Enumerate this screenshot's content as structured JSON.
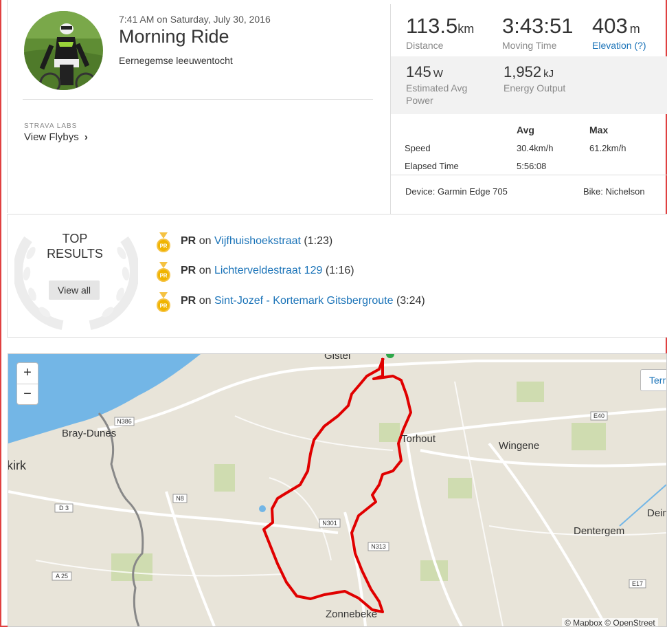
{
  "activity": {
    "datetime": "7:41 AM on Saturday, July 30, 2016",
    "title": "Morning Ride",
    "description": "Eernegemse leeuwentocht"
  },
  "labs": {
    "tag": "STRAVA LABS",
    "link": "View Flybys"
  },
  "stats": {
    "distance": {
      "value": "113.5",
      "unit": "km",
      "label": "Distance"
    },
    "moving_time": {
      "value": "3:43:51",
      "label": "Moving Time"
    },
    "elevation": {
      "value": "403",
      "unit": "m",
      "label": "Elevation (?)"
    },
    "power": {
      "value": "145",
      "unit": "W",
      "label_line1": "Estimated Avg",
      "label_line2": "Power"
    },
    "energy": {
      "value": "1,952",
      "unit": "kJ",
      "label": "Energy Output"
    }
  },
  "detail_table": {
    "headers": [
      "",
      "Avg",
      "Max"
    ],
    "rows": [
      {
        "label": "Speed",
        "avg": "30.4km/h",
        "max": "61.2km/h"
      },
      {
        "label": "Elapsed Time",
        "avg": "5:56:08",
        "max": ""
      }
    ]
  },
  "device": "Device: Garmin Edge 705",
  "bike": "Bike: Nichelson",
  "results": {
    "title_line1": "TOP",
    "title_line2": "RESULTS",
    "view_all": "View all",
    "medal_text": "PR",
    "items": [
      {
        "badge": "PR",
        "prep": "on",
        "segment": "Vijfhuishoekstraat",
        "time": "(1:23)"
      },
      {
        "badge": "PR",
        "prep": "on",
        "segment": "Lichterveldestraat 129",
        "time": "(1:16)"
      },
      {
        "badge": "PR",
        "prep": "on",
        "segment": "Sint-Jozef - Kortemark Gitsbergroute",
        "time": "(3:24)"
      }
    ]
  },
  "map": {
    "zoom_in": "+",
    "zoom_out": "−",
    "terrain": "Terr",
    "attribution": "© Mapbox © OpenStreet",
    "places": [
      "Gistel",
      "Bray-Dunes",
      "kirk",
      "Torhout",
      "Wingene",
      "Dentergem",
      "Deinz",
      "Zonnebeke"
    ],
    "roads": [
      "N386",
      "D 3",
      "N8",
      "A 25",
      "N301",
      "N313",
      "E40",
      "E17"
    ]
  },
  "colors": {
    "route": "#e00000",
    "link": "#1a73b8",
    "sea": "#73b6e6",
    "land": "#e8e4d9"
  }
}
